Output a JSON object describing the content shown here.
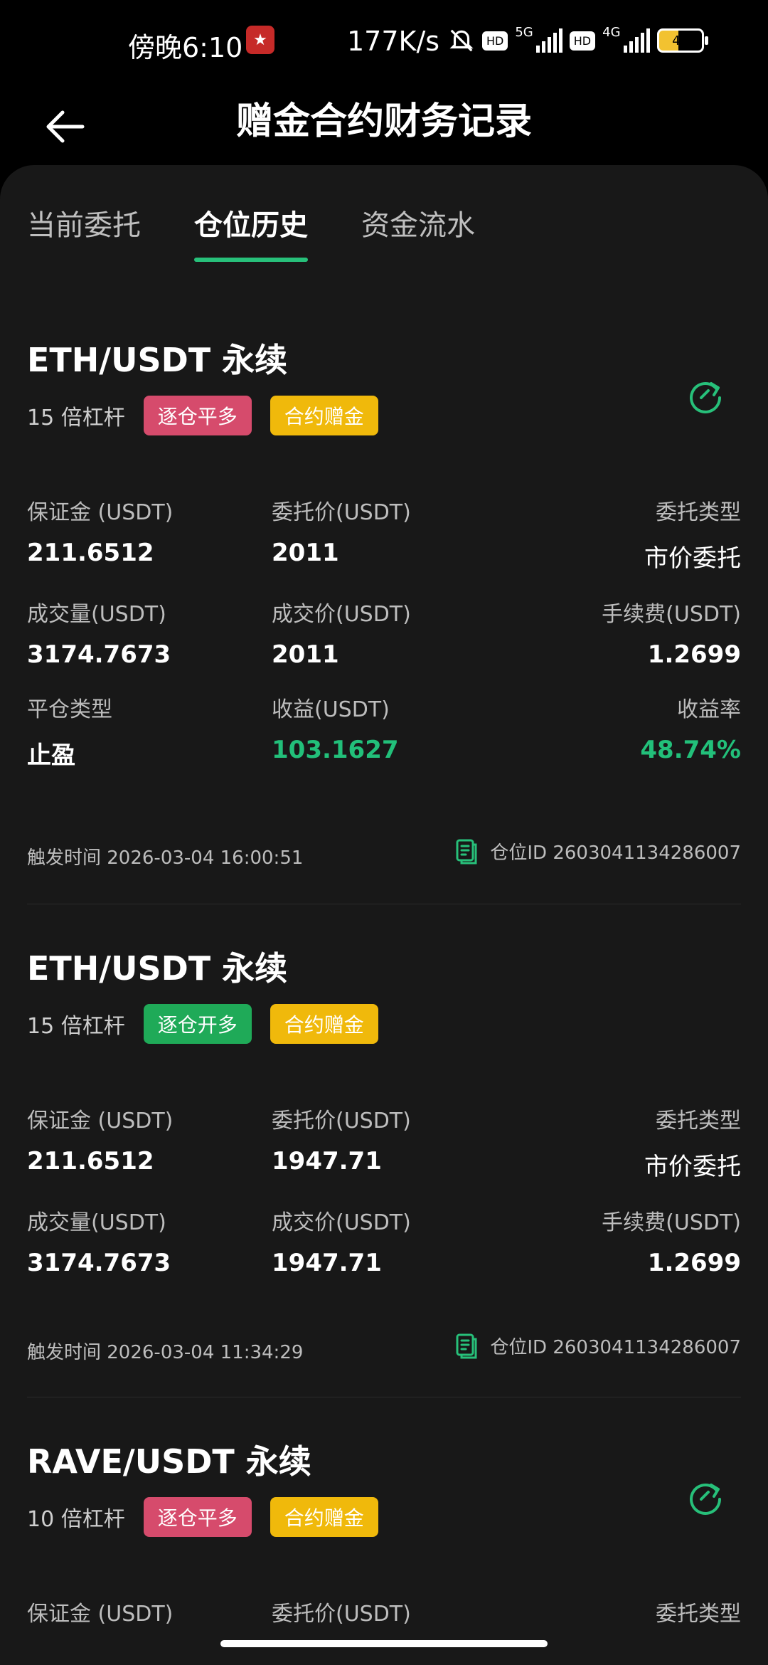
{
  "status_bar": {
    "time": "傍晚6:10",
    "speed": "177K/s",
    "hd": "HD",
    "tech1": "5G",
    "tech2": "4G",
    "battery": "45"
  },
  "header": {
    "title": "赠金合约财务记录"
  },
  "tabs": [
    {
      "label": "当前委托"
    },
    {
      "label": "仓位历史"
    },
    {
      "label": "资金流水"
    }
  ],
  "records": [
    {
      "symbol": "ETH/USDT 永续",
      "leverage": "15 倍杠杆",
      "badge_action": "逐仓平多",
      "badge_type": "合约赠金",
      "fields": [
        {
          "label": "保证金 (USDT)",
          "value": "211.6512"
        },
        {
          "label": "委托价(USDT)",
          "value": "2011"
        },
        {
          "label": "委托类型",
          "value": "市价委托"
        },
        {
          "label": "成交量(USDT)",
          "value": "3174.7673"
        },
        {
          "label": "成交价(USDT)",
          "value": "2011"
        },
        {
          "label": "手续费(USDT)",
          "value": "1.2699"
        },
        {
          "label": "平仓类型",
          "value": "止盈"
        },
        {
          "label": "收益(USDT)",
          "value": "103.1627"
        },
        {
          "label": "收益率",
          "value": "48.74%"
        }
      ],
      "trigger_time": "触发时间 2026-03-04 16:00:51",
      "position_id": "仓位ID 2603041134286007"
    },
    {
      "symbol": "ETH/USDT 永续",
      "leverage": "15 倍杠杆",
      "badge_action": "逐仓开多",
      "badge_type": "合约赠金",
      "fields": [
        {
          "label": "保证金 (USDT)",
          "value": "211.6512"
        },
        {
          "label": "委托价(USDT)",
          "value": "1947.71"
        },
        {
          "label": "委托类型",
          "value": "市价委托"
        },
        {
          "label": "成交量(USDT)",
          "value": "3174.7673"
        },
        {
          "label": "成交价(USDT)",
          "value": "1947.71"
        },
        {
          "label": "手续费(USDT)",
          "value": "1.2699"
        }
      ],
      "trigger_time": "触发时间 2026-03-04 11:34:29",
      "position_id": "仓位ID 2603041134286007"
    },
    {
      "symbol": "RAVE/USDT 永续",
      "leverage": "10 倍杠杆",
      "badge_action": "逐仓平多",
      "badge_type": "合约赠金",
      "fields": [
        {
          "label": "保证金 (USDT)"
        },
        {
          "label": "委托价(USDT)"
        },
        {
          "label": "委托类型"
        }
      ]
    }
  ],
  "colors": {
    "accent": "#27c07a",
    "badge_red": "#d64b6c",
    "badge_green": "#1faa58",
    "badge_gold": "#f0b90b",
    "card_bg": "#181818"
  }
}
